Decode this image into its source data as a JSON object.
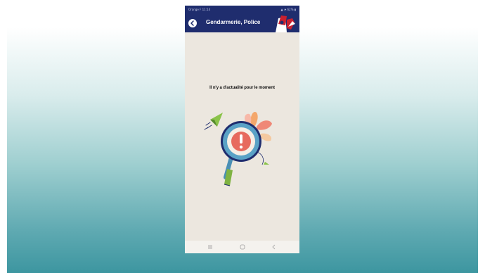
{
  "status_bar": {
    "carrier_time": "Orange F 11:14",
    "indicators": "▲ ◔ 62% ▮"
  },
  "app_bar": {
    "title": "Gendarmerie, Police",
    "back_icon": "chevron-left-icon",
    "logo": "gendarmerie-logo"
  },
  "content": {
    "empty_message": "Il n'y a d'actualité pour le moment"
  },
  "nav_bar": {
    "items": [
      "recent-apps-icon",
      "home-icon",
      "back-icon"
    ]
  },
  "colors": {
    "app_bar": "#1f2d6e",
    "screen_background": "#ece7df",
    "alert_red": "#e76a5e",
    "lens_blue": "#4a8fb5",
    "handle_green": "#7fb342"
  }
}
